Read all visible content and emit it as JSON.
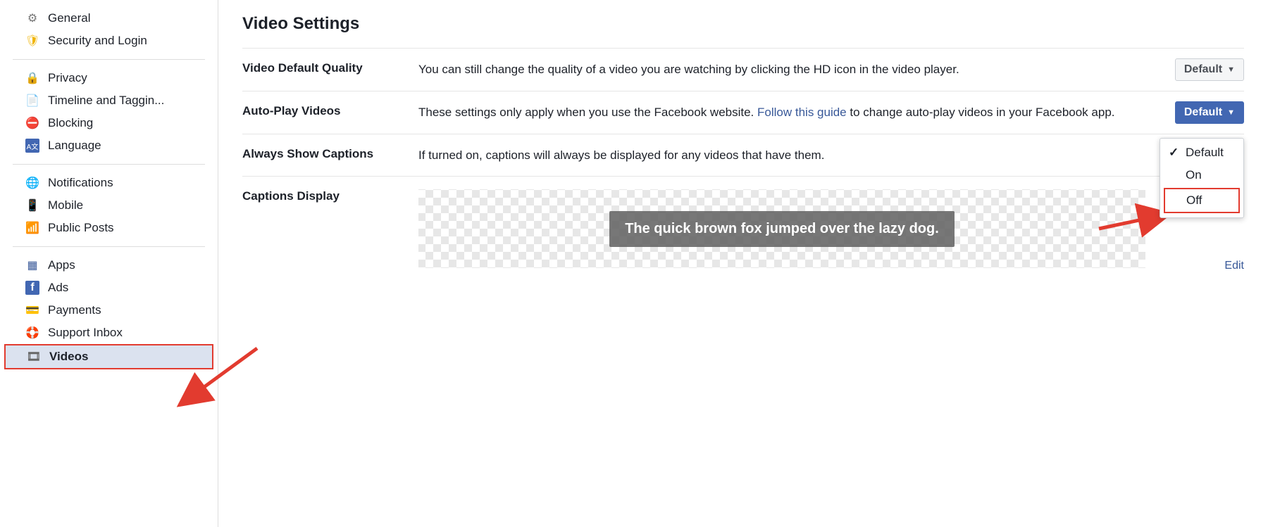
{
  "sidebar": {
    "groups": [
      [
        {
          "label": "General",
          "icon": "⚙"
        },
        {
          "label": "Security and Login",
          "icon": "🛡"
        }
      ],
      [
        {
          "label": "Privacy",
          "icon": "🔒"
        },
        {
          "label": "Timeline and Taggin...",
          "icon": "📄"
        },
        {
          "label": "Blocking",
          "icon": "⛔"
        },
        {
          "label": "Language",
          "icon": "A文"
        }
      ],
      [
        {
          "label": "Notifications",
          "icon": "🌐"
        },
        {
          "label": "Mobile",
          "icon": "📱"
        },
        {
          "label": "Public Posts",
          "icon": "📶"
        }
      ],
      [
        {
          "label": "Apps",
          "icon": "▦"
        },
        {
          "label": "Ads",
          "icon": "f"
        },
        {
          "label": "Payments",
          "icon": "💳"
        },
        {
          "label": "Support Inbox",
          "icon": "🛟"
        },
        {
          "label": "Videos",
          "icon": "🎞",
          "active": true
        }
      ]
    ]
  },
  "page": {
    "title": "Video Settings",
    "rows": {
      "quality": {
        "label": "Video Default Quality",
        "desc": "You can still change the quality of a video you are watching by clicking the HD icon in the video player.",
        "select": "Default"
      },
      "autoplay": {
        "label": "Auto-Play Videos",
        "desc_pre": "These settings only apply when you use the Facebook website. ",
        "desc_link": "Follow this guide",
        "desc_post": " to change auto-play videos in your Facebook app.",
        "select": "Default",
        "options": [
          {
            "label": "Default",
            "checked": true
          },
          {
            "label": "On"
          },
          {
            "label": "Off",
            "highlight": true
          }
        ]
      },
      "captions": {
        "label": "Always Show Captions",
        "desc": "If turned on, captions will always be displayed for any videos that have them."
      },
      "caption_display": {
        "label": "Captions Display",
        "preview": "The quick brown fox jumped over the lazy dog.",
        "edit": "Edit"
      }
    }
  }
}
